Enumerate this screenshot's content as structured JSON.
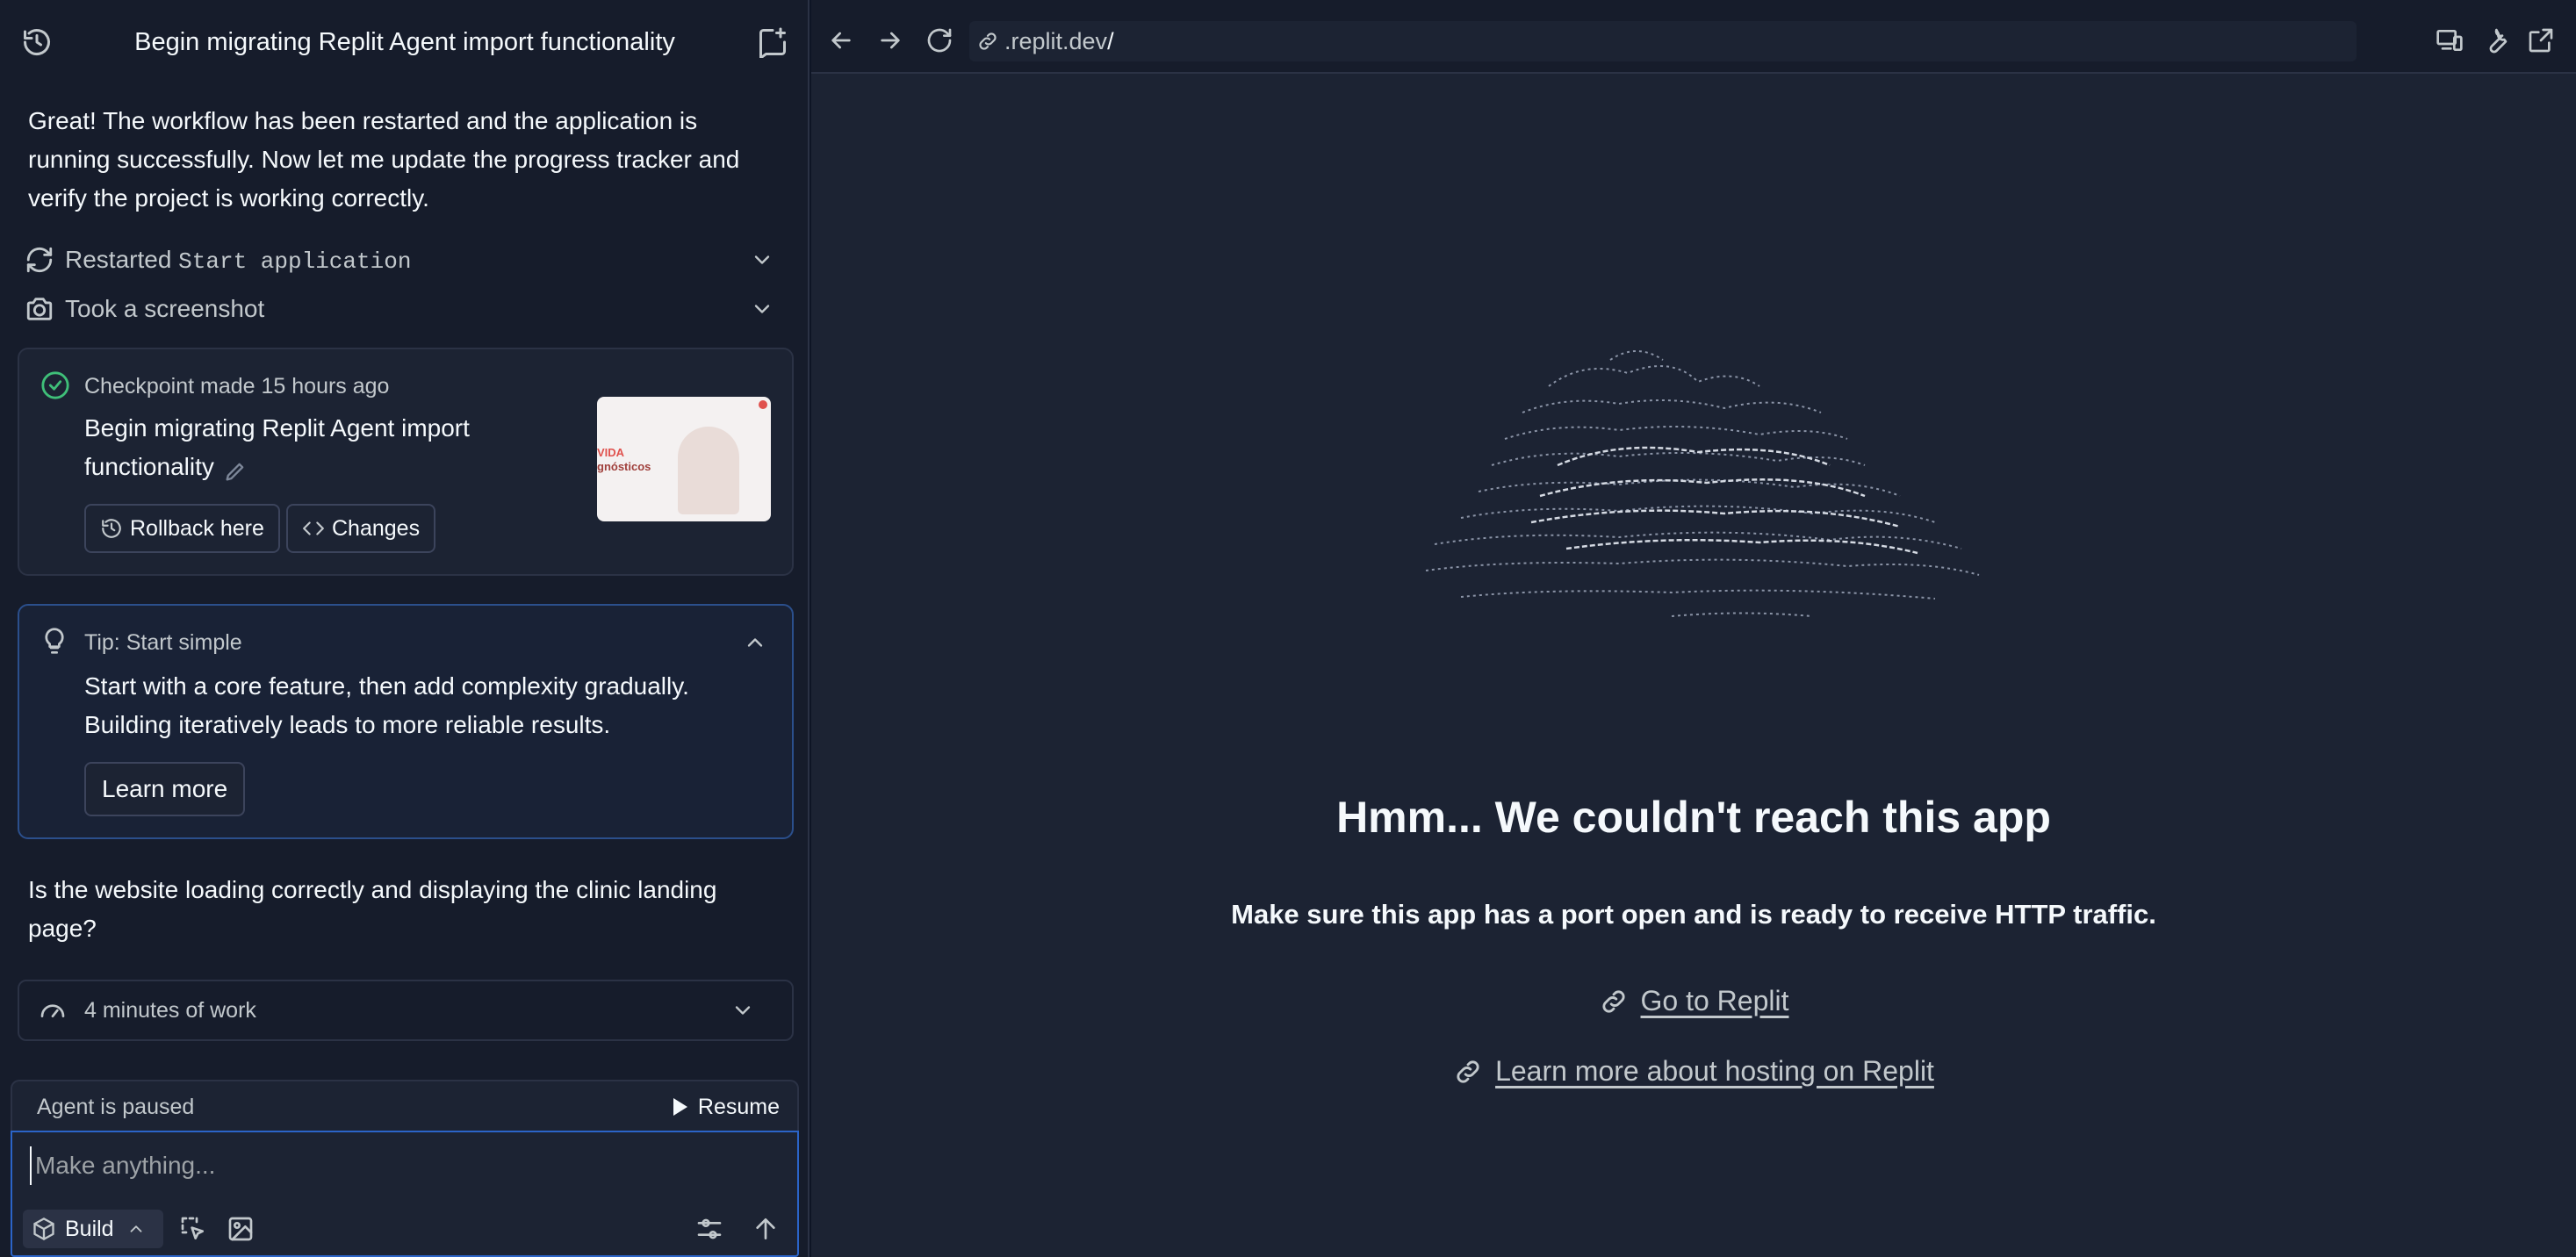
{
  "chat": {
    "title": "Begin migrating Replit Agent import functionality",
    "message1": "Great! The workflow has been restarted and the application is running successfully. Now let me update the progress tracker and verify the project is working correctly.",
    "actions": [
      {
        "prefix": "Restarted ",
        "code": "Start application",
        "icon": "refresh-icon"
      },
      {
        "prefix": "Took a screenshot",
        "code": "",
        "icon": "camera-icon"
      }
    ],
    "checkpoint": {
      "meta": "Checkpoint made 15 hours ago",
      "title": "Begin migrating Replit Agent import functionality",
      "rollback_label": "Rollback here",
      "changes_label": "Changes",
      "thumb_line1": "VIDA",
      "thumb_line2": "gnósticos"
    },
    "tip": {
      "title": "Tip: Start simple",
      "body": "Start with a core feature, then add complexity gradually. Building iteratively leads to more reliable results.",
      "button": "Learn more"
    },
    "message2": "Is the website loading correctly and displaying the clinic landing page?",
    "work_summary": "4 minutes of work",
    "paused_text": "Agent is paused",
    "resume_label": "Resume",
    "input_placeholder": "Make anything...",
    "build_label": "Build"
  },
  "browser": {
    "url_prefix": ".replit.dev",
    "url_suffix": "/",
    "error_title": "Hmm... We couldn't reach this app",
    "error_subtitle": "Make sure this app has a port open and is ready to receive HTTP traffic.",
    "links": [
      {
        "label": "Go to Replit",
        "icon": "link-icon"
      },
      {
        "label": "Learn more about hosting on Replit",
        "icon": "link-icon"
      }
    ]
  },
  "colors": {
    "background": "#0e1525",
    "panel": "#161c2b",
    "success": "#3fbf79",
    "focus": "#2b64c8"
  }
}
